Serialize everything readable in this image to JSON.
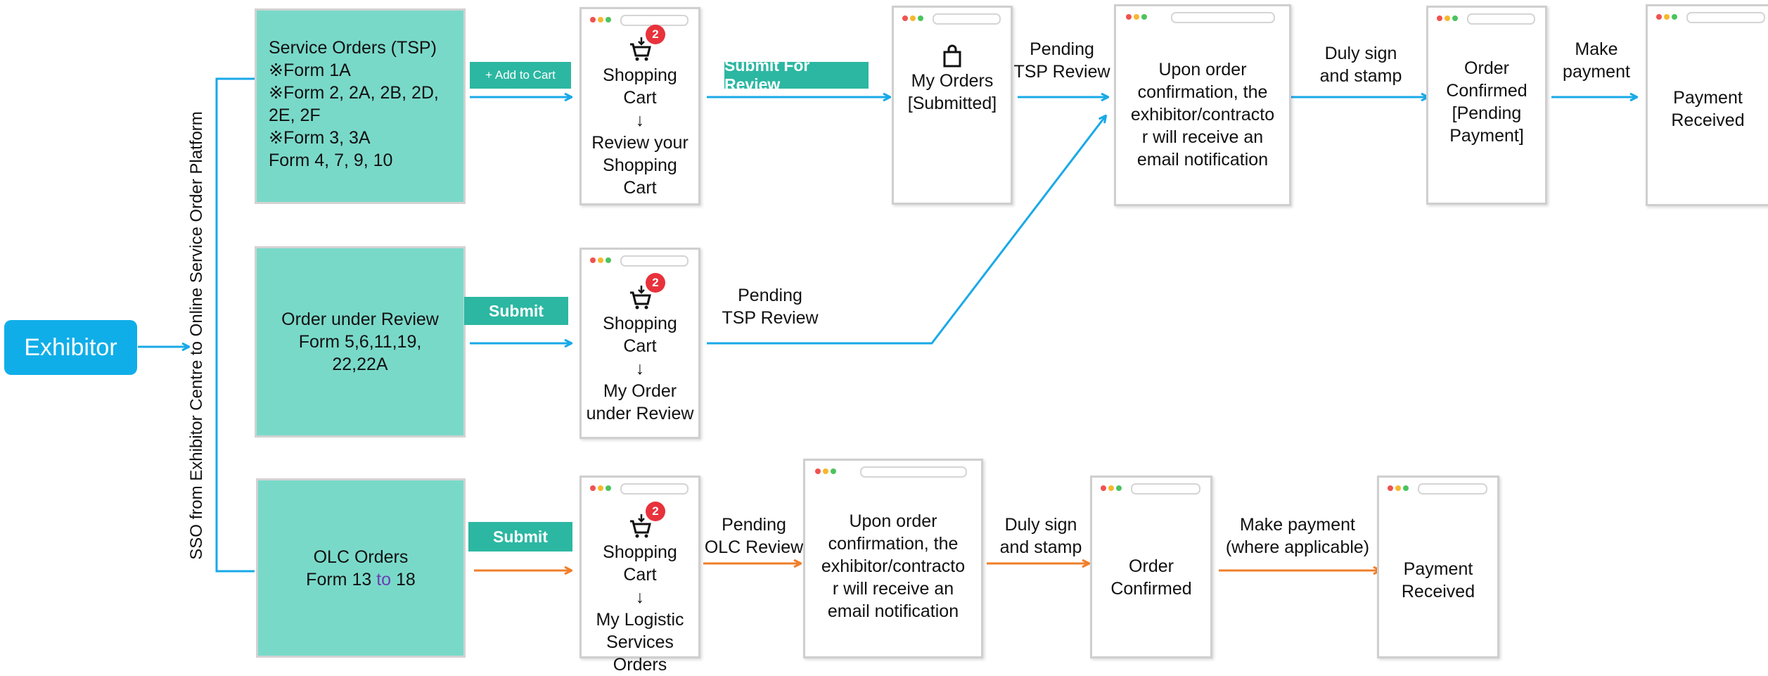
{
  "exhibitor_label": "Exhibitor",
  "vertical_label": "SSO from Exhibitor Centre to Online Service Order  Platform",
  "row1": {
    "box_lines": [
      "Service Orders (TSP)",
      "※Form 1A",
      "※Form 2, 2A, 2B, 2D,",
      "2E, 2F",
      "※Form 3, 3A",
      "Form 4, 7, 9, 10"
    ],
    "button": "+ Add to Cart",
    "cart": {
      "badge": "2",
      "line1": "Shopping",
      "line2": "Cart",
      "arrow": "↓",
      "line3": "Review your",
      "line4": "Shopping",
      "line5": "Cart"
    },
    "button2": "Submit For Review",
    "my_orders": {
      "line1": "My Orders",
      "line2": "[Submitted]"
    },
    "pending": {
      "line1": "Pending",
      "line2": "TSP Review"
    },
    "confirm_text": {
      "line1": "Upon order",
      "line2": "confirmation, the",
      "line3": "exhibitor/contracto",
      "line4": "r will receive an",
      "line5": "email notification"
    },
    "duly": {
      "line1": "Duly sign",
      "line2": "and stamp"
    },
    "order_confirmed": {
      "line1": "Order",
      "line2": "Confirmed",
      "line3": "[Pending",
      "line4": "Payment]"
    },
    "make_payment": {
      "line1": "Make",
      "line2": "payment"
    },
    "payment_received": {
      "line1": "Payment",
      "line2": "Received"
    }
  },
  "row2": {
    "box_lines": [
      "Order under Review",
      "Form 5,6,11,19,",
      "22,22A"
    ],
    "button": "Submit",
    "cart": {
      "badge": "2",
      "line1": "Shopping",
      "line2": "Cart",
      "arrow": "↓",
      "line3": "My Order",
      "line4": "under Review"
    },
    "pending": {
      "line1": "Pending",
      "line2": "TSP Review"
    }
  },
  "row3": {
    "box_line1": "OLC Orders",
    "box_line2_a": "Form 13 ",
    "box_line2_b": "to",
    "box_line2_c": " 18",
    "button": "Submit",
    "cart": {
      "badge": "2",
      "line1": "Shopping",
      "line2": "Cart",
      "arrow": "↓",
      "line3": "My Logistic",
      "line4": "Services",
      "line5": "Orders"
    },
    "pending": {
      "line1": "Pending",
      "line2": "OLC Review"
    },
    "confirm_text": {
      "line1": "Upon order",
      "line2": "confirmation, the",
      "line3": "exhibitor/contracto",
      "line4": "r will receive an",
      "line5": "email notification"
    },
    "duly": {
      "line1": "Duly sign",
      "line2": "and stamp"
    },
    "order_confirmed": {
      "line1": "Order",
      "line2": "Confirmed"
    },
    "make_payment": {
      "line1": "Make payment",
      "line2": "(where applicable)"
    },
    "payment_received": {
      "line1": "Payment",
      "line2": "Received"
    }
  },
  "colors": {
    "blue": "#19a9e8",
    "orange": "#f07f2a",
    "teal": "#79d9c9",
    "button": "#2cb7a2",
    "exhibitor": "#10aee8",
    "badge": "#e8323c"
  }
}
